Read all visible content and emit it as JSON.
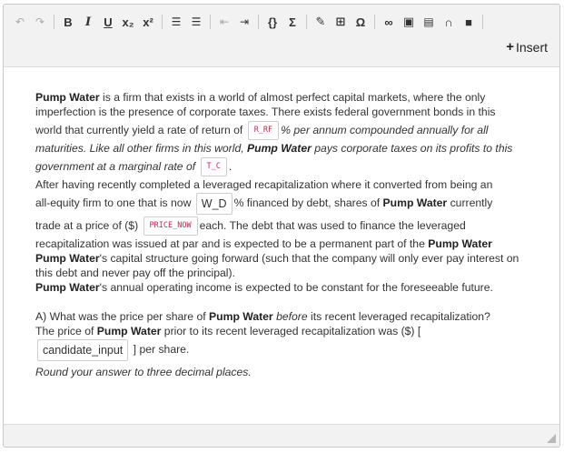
{
  "toolbar": {
    "buttons": [
      {
        "name": "undo-icon",
        "glyph": "↶"
      },
      {
        "name": "redo-icon",
        "glyph": "↷"
      },
      {
        "name": "bold-icon",
        "glyph": "B"
      },
      {
        "name": "italic-icon",
        "glyph": "I"
      },
      {
        "name": "underline-icon",
        "glyph": "U"
      },
      {
        "name": "subscript-icon",
        "glyph": "x₂"
      },
      {
        "name": "superscript-icon",
        "glyph": "x²"
      },
      {
        "name": "ordered-list-icon",
        "glyph": "☰"
      },
      {
        "name": "unordered-list-icon",
        "glyph": "☰"
      },
      {
        "name": "outdent-icon",
        "glyph": "⇤"
      },
      {
        "name": "indent-icon",
        "glyph": "⇥"
      },
      {
        "name": "code-icon",
        "glyph": "{}"
      },
      {
        "name": "sigma-icon",
        "glyph": "Σ"
      },
      {
        "name": "pencil-icon",
        "glyph": "✎"
      },
      {
        "name": "table-icon",
        "glyph": "⊞"
      },
      {
        "name": "omega-icon",
        "glyph": "Ω"
      },
      {
        "name": "link-icon",
        "glyph": "∞"
      },
      {
        "name": "image-icon",
        "glyph": "▣"
      },
      {
        "name": "pdf-icon",
        "glyph": "▤"
      },
      {
        "name": "headphones-icon",
        "glyph": "∩"
      },
      {
        "name": "video-icon",
        "glyph": "■"
      }
    ],
    "insert_label": "Insert",
    "insert_plus": "+"
  },
  "content": {
    "company": "Pump Water",
    "p1": {
      "l1_rest": " is a firm that exists in a world of almost perfect capital markets, where the only",
      "l2": "imperfection is the presence of corporate taxes. There exists federal government bonds in this",
      "l3_a": "world that currently yield a rate of return of",
      "tag_rrf": "R_RF",
      "l3_b": "% per annum compounded annually for all",
      "l4_a": "maturities. Like all other firms in this world,",
      "l4_b": " pays corporate taxes on its profits to this",
      "l5_a": "government at a marginal rate of",
      "tag_tc": "T_C",
      "l5_b": "."
    },
    "p2": {
      "l1": "After having recently completed a leveraged recapitalization where it converted from being an",
      "l2_a": "all-equity firm to one that is now",
      "box_wd": "W_D",
      "l2_b": "% financed by debt, shares of",
      "l2_c": " currently",
      "l3_a": "trade at a price of ($)",
      "tag_price": "PRICE_NOW",
      "l3_b": "each. The debt that was used to finance the leveraged",
      "l4_a": "recapitalization was issued at par and is expected to be a permanent part of the",
      "l5_a": "'s capital structure going forward (such that the company will only ever pay interest on",
      "l6": "this debt and never pay off the principal)."
    },
    "p3_rest": "'s annual operating income is expected to be constant for the foreseeable future.",
    "qa": {
      "l1_a": "A) What was the price per share of",
      "l1_b": "before",
      "l1_c": " its recent leveraged recapitalization?",
      "l2_a": "The price of",
      "l2_b": " prior to its recent leveraged recapitalization was ($) [",
      "candidate": "candidate_input",
      "l3_b": "] per share.",
      "l4": "Round your answer to three decimal places."
    }
  }
}
